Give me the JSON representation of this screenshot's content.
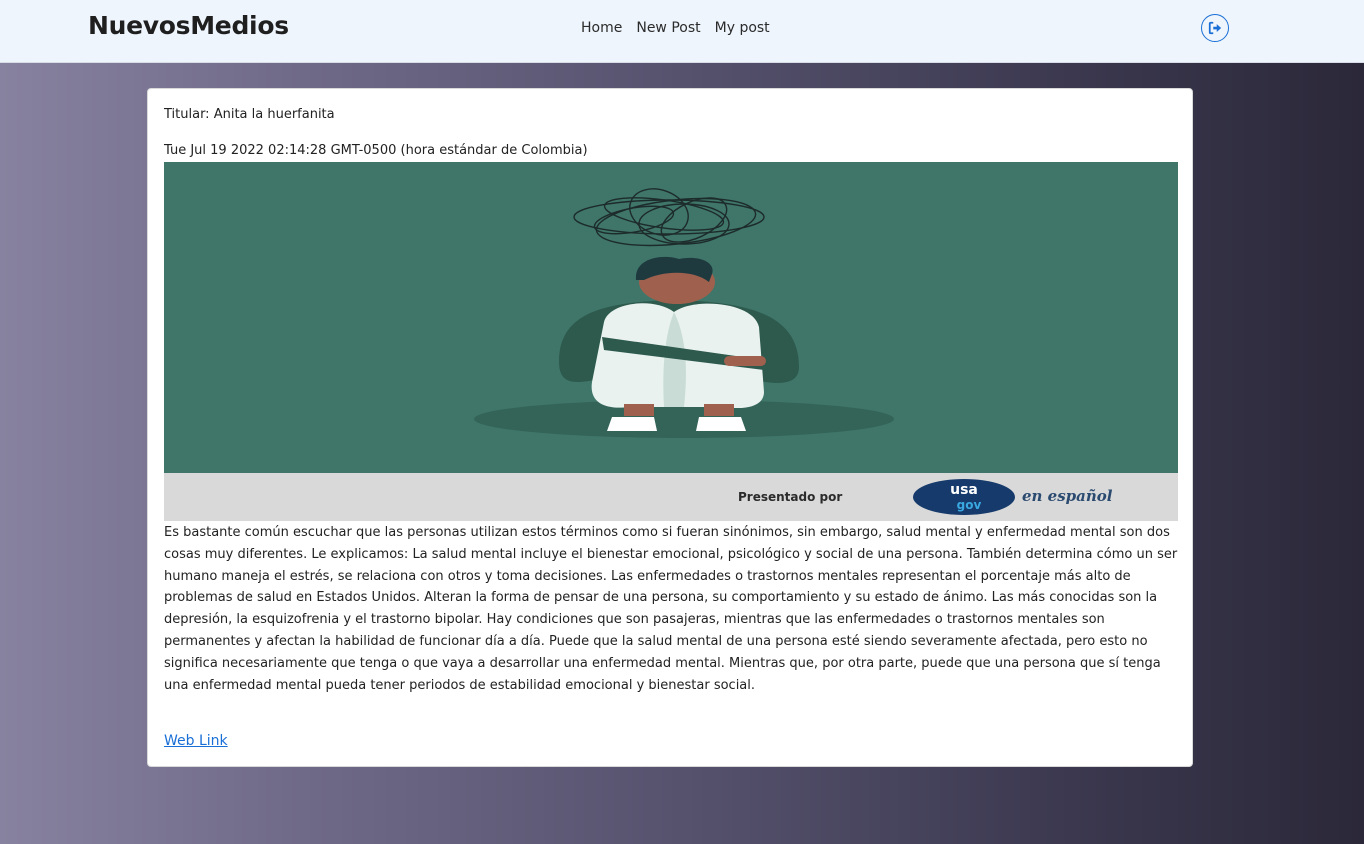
{
  "nav": {
    "brand": "NuevosMedios",
    "links": [
      "Home",
      "New Post",
      "My post"
    ],
    "logout_icon": "logout-icon"
  },
  "post": {
    "title_line": "Titular: Anita la huerfanita",
    "date": "Tue Jul 19 2022 02:14:28 GMT-0500 (hora estándar de Colombia)",
    "image": {
      "banner_text": "Presentado por",
      "logo_top": "usa",
      "logo_bottom": "gov",
      "logo_suffix": "en español",
      "bg_color": "#3f7669"
    },
    "body": "Es bastante común escuchar que las personas utilizan estos términos como si fueran sinónimos, sin embargo, salud mental y enfermedad mental son dos cosas muy diferentes. Le explicamos: La salud mental incluye el bienestar emocional, psicológico y social de una persona. También determina cómo un ser humano maneja el estrés, se relaciona con otros y toma decisiones. Las enfermedades o trastornos mentales representan el porcentaje más alto de problemas de salud en Estados Unidos. Alteran la forma de pensar de una persona, su comportamiento y su estado de ánimo. Las más conocidas son la depresión, la esquizofrenia y el trastorno bipolar. Hay condiciones que son pasajeras, mientras que las enfermedades o trastornos mentales son permanentes y afectan la habilidad de funcionar día a día. Puede que la salud mental de una persona esté siendo severamente afectada, pero esto no significa necesariamente que tenga o que vaya a desarrollar una enfermedad mental. Mientras que, por otra parte, puede que una persona que sí tenga una enfermedad mental pueda tener periodos de estabilidad emocional y bienestar social.",
    "link_label": "Web Link"
  },
  "colors": {
    "accent": "#1a6fd6",
    "navbar": "#eef5fc"
  }
}
